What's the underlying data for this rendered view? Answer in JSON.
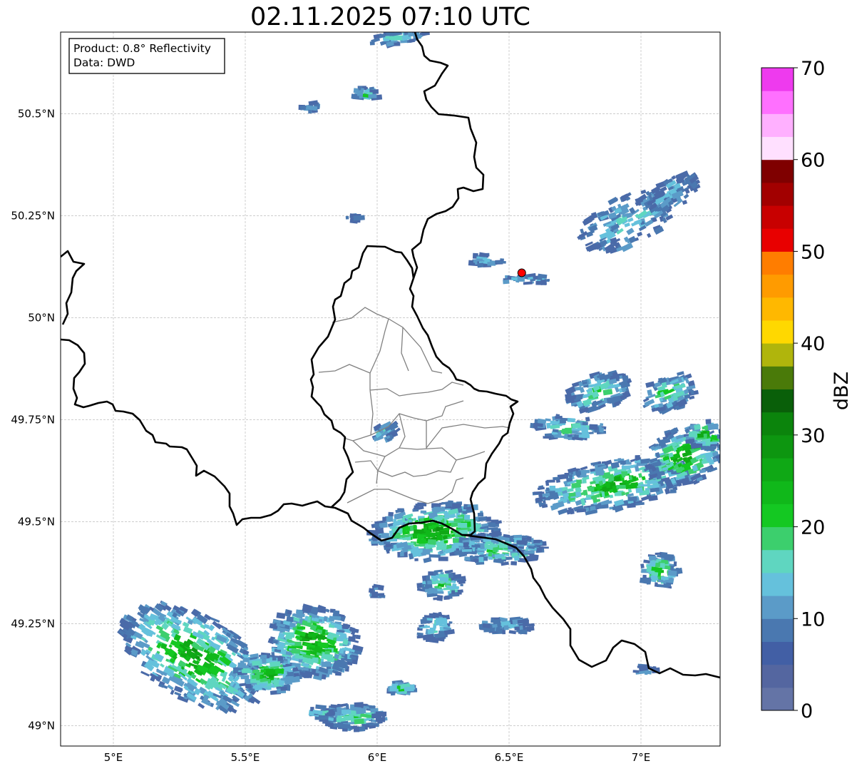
{
  "title": "02.11.2025 07:10 UTC",
  "info_box": {
    "product": "Product: 0.8° Reflectivity",
    "data": "Data: DWD"
  },
  "map": {
    "lon_range": [
      4.8,
      7.3
    ],
    "lat_range": [
      48.95,
      50.7
    ],
    "lon_ticks": [
      {
        "value": 5.0,
        "label": "5°E"
      },
      {
        "value": 5.5,
        "label": "5.5°E"
      },
      {
        "value": 6.0,
        "label": "6°E"
      },
      {
        "value": 6.5,
        "label": "6.5°E"
      },
      {
        "value": 7.0,
        "label": "7°E"
      }
    ],
    "lat_ticks": [
      {
        "value": 49.0,
        "label": "49°N"
      },
      {
        "value": 49.25,
        "label": "49.25°N"
      },
      {
        "value": 49.5,
        "label": "49.5°N"
      },
      {
        "value": 49.75,
        "label": "49.75°N"
      },
      {
        "value": 50.0,
        "label": "50°N"
      },
      {
        "value": 50.25,
        "label": "50.25°N"
      },
      {
        "value": 50.5,
        "label": "50.5°N"
      }
    ],
    "gridlines": true,
    "radar_site": {
      "lon": 6.548,
      "lat": 50.11,
      "color": "#ff0000"
    }
  },
  "colorbar": {
    "label": "dBZ",
    "range": [
      0,
      70
    ],
    "tick_values": [
      0,
      10,
      20,
      30,
      40,
      50,
      60,
      70
    ],
    "tick_labels": [
      "0",
      "10",
      "20",
      "30",
      "40",
      "50",
      "60",
      "70"
    ],
    "colors": [
      "#6474a6",
      "#5466a0",
      "#425fa5",
      "#4a78b0",
      "#5b9bc8",
      "#65c1dc",
      "#5fd6c0",
      "#3ccf6d",
      "#14c822",
      "#10b81a",
      "#0fa815",
      "#0d9610",
      "#0b840c",
      "#095f09",
      "#4a7a09",
      "#b0b50c",
      "#ffd800",
      "#ffb800",
      "#ff9b00",
      "#ff7d00",
      "#e80000",
      "#c80000",
      "#a20000",
      "#7f0000",
      "#ffe0ff",
      "#ffb0ff",
      "#ff70ff",
      "#ee3aee"
    ]
  }
}
